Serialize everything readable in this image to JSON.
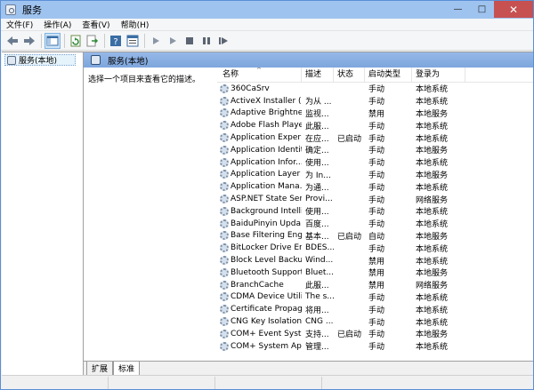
{
  "window": {
    "title": "服务"
  },
  "menubar": [
    "文件(F)",
    "操作(A)",
    "查看(V)",
    "帮助(H)"
  ],
  "toolbar": {
    "icons": [
      "back-arrow-icon",
      "forward-arrow-icon",
      "show-hide-console-tree-icon",
      "refresh-icon",
      "export-list-icon",
      "help-icon",
      "properties-icon",
      "start-service-icon",
      "start-service-alt-icon",
      "stop-service-icon",
      "pause-service-icon",
      "restart-service-icon"
    ]
  },
  "tree": {
    "root_label": "服务(本地)"
  },
  "panel": {
    "header": "服务(本地)",
    "description_hint": "选择一个项目来查看它的描述。"
  },
  "list": {
    "columns": [
      "名称",
      "描述",
      "状态",
      "启动类型",
      "登录为"
    ],
    "rows": [
      [
        "360CaSrv",
        "",
        "",
        "手动",
        "本地系统"
      ],
      [
        "ActiveX Installer (...",
        "为从 ...",
        "",
        "手动",
        "本地系统"
      ],
      [
        "Adaptive Brightness",
        "监视...",
        "",
        "禁用",
        "本地服务"
      ],
      [
        "Adobe Flash Playe...",
        "此服...",
        "",
        "手动",
        "本地系统"
      ],
      [
        "Application Experi...",
        "在应...",
        "已启动",
        "手动",
        "本地系统"
      ],
      [
        "Application Identity",
        "确定...",
        "",
        "手动",
        "本地服务"
      ],
      [
        "Application Infor...",
        "使用...",
        "",
        "手动",
        "本地系统"
      ],
      [
        "Application Layer ...",
        "为 In...",
        "",
        "手动",
        "本地服务"
      ],
      [
        "Application Mana...",
        "为通...",
        "",
        "手动",
        "本地系统"
      ],
      [
        "ASP.NET State Ser...",
        "Provi...",
        "",
        "手动",
        "网络服务"
      ],
      [
        "Background Intelli...",
        "使用...",
        "",
        "手动",
        "本地系统"
      ],
      [
        "BaiduPinyin Upda...",
        "百度...",
        "",
        "手动",
        "本地系统"
      ],
      [
        "Base Filtering Engi...",
        "基本...",
        "已启动",
        "自动",
        "本地服务"
      ],
      [
        "BitLocker Drive En...",
        "BDES...",
        "",
        "手动",
        "本地系统"
      ],
      [
        "Block Level Backu...",
        "Wind...",
        "",
        "禁用",
        "本地系统"
      ],
      [
        "Bluetooth Support...",
        "Bluet...",
        "",
        "禁用",
        "本地服务"
      ],
      [
        "BranchCache",
        "此服...",
        "",
        "禁用",
        "网络服务"
      ],
      [
        "CDMA Device Utili...",
        "The s...",
        "",
        "手动",
        "本地系统"
      ],
      [
        "Certificate Propag...",
        "将用...",
        "",
        "手动",
        "本地系统"
      ],
      [
        "CNG Key Isolation",
        "CNG ...",
        "",
        "手动",
        "本地系统"
      ],
      [
        "COM+ Event Syst...",
        "支持...",
        "已启动",
        "手动",
        "本地服务"
      ],
      [
        "COM+ System Ap...",
        "管理...",
        "",
        "手动",
        "本地系统"
      ]
    ]
  },
  "tabs": [
    "扩展",
    "标准"
  ]
}
